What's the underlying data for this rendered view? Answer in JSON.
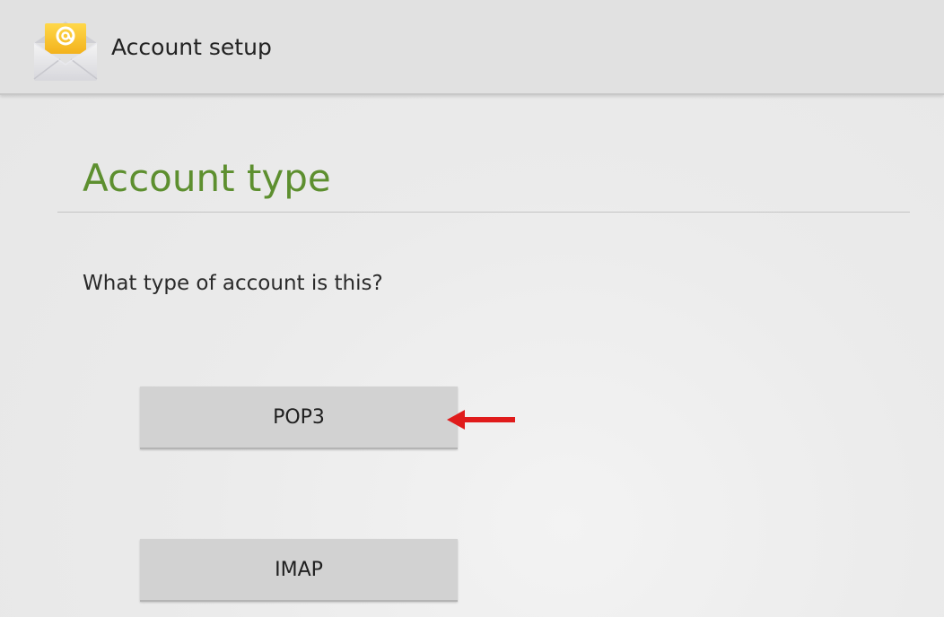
{
  "action_bar": {
    "title": "Account setup",
    "icon": "email-envelope-icon",
    "accent_color": "#f7c62b"
  },
  "main": {
    "section_title": "Account type",
    "section_title_color": "#5d8f2f",
    "prompt": "What type of account is this?",
    "options": [
      {
        "label": "POP3"
      },
      {
        "label": "IMAP"
      }
    ]
  },
  "annotation": {
    "icon": "red-arrow-icon",
    "color": "#e01b1b"
  }
}
